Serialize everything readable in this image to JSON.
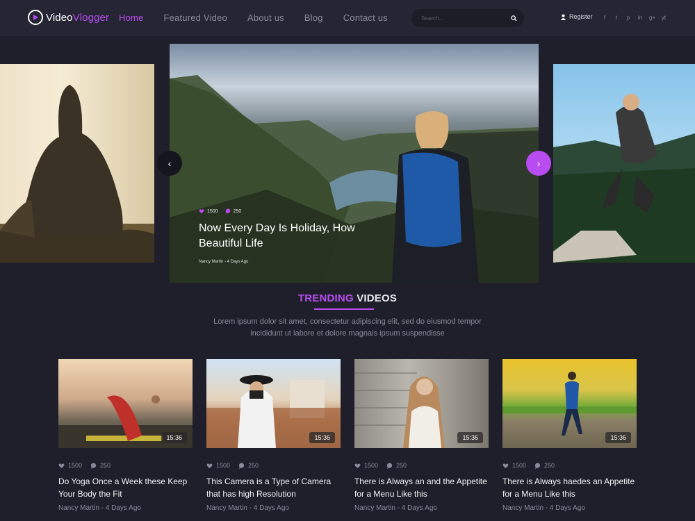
{
  "brand": {
    "name_a": "Video",
    "name_b": "Vlogger",
    "accent": "#b94cf0"
  },
  "nav": {
    "items": [
      {
        "label": "Home",
        "active": true
      },
      {
        "label": "Featured Video",
        "active": false
      },
      {
        "label": "About us",
        "active": false
      },
      {
        "label": "Blog",
        "active": false
      },
      {
        "label": "Contact us",
        "active": false
      }
    ],
    "search_placeholder": "Search...",
    "register_label": "Register",
    "socials": [
      "f",
      "t",
      "p",
      "in",
      "g+",
      "yt"
    ]
  },
  "hero": {
    "likes": "1500",
    "comments": "250",
    "title": "Now Every Day Is Holiday, How Beautiful Life",
    "meta": "Nancy Martin - 4 Days Ago",
    "prev_icon": "chevron-left-icon",
    "next_icon": "chevron-right-icon"
  },
  "section": {
    "title_a": "TRENDING",
    "title_b": "VIDEOS",
    "description": "Lorem ipsum dolor sit amet, consectetur adipiscing elit, sed do eiusmod tempor incididunt ut labore et dolore magnais ipsum suspendisse"
  },
  "cards": [
    {
      "duration": "15:36",
      "likes": "1500",
      "comments": "250",
      "title": "Do Yoga Once a Week these Keep Your Body the Fit",
      "meta": "Nancy Martin - 4 Days Ago"
    },
    {
      "duration": "15:36",
      "likes": "1500",
      "comments": "250",
      "title": "This Camera is a Type of Camera that has high Resolution",
      "meta": "Nancy Martin - 4 Days Ago"
    },
    {
      "duration": "15:36",
      "likes": "1500",
      "comments": "250",
      "title": "There  is Always an and the Appetite for a Menu Like this",
      "meta": "Nancy Martin - 4 Days Ago"
    },
    {
      "duration": "15:36",
      "likes": "1500",
      "comments": "250",
      "title": "There  is Always haedes an Appetite for a Menu Like this",
      "meta": "Nancy Martin - 4 Days Ago"
    }
  ]
}
